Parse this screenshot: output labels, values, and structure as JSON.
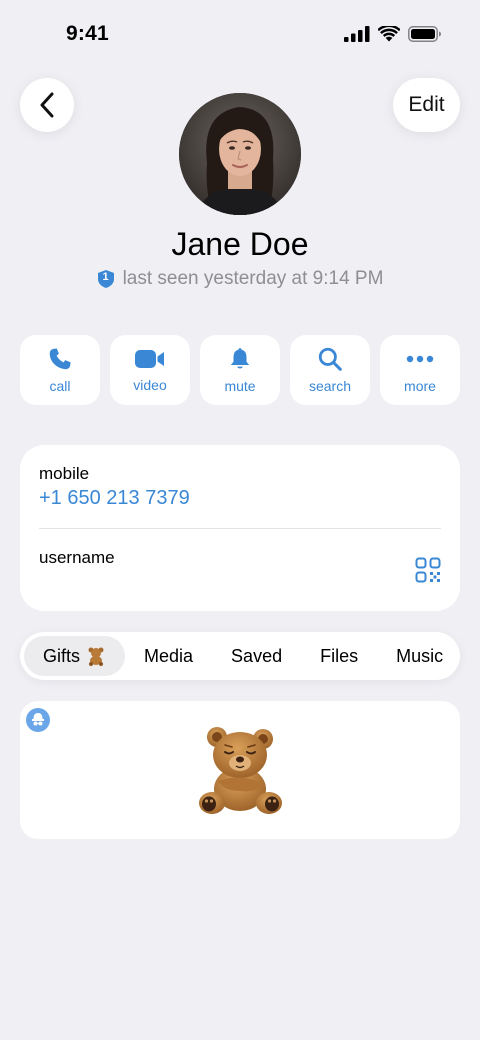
{
  "status_bar": {
    "time": "9:41",
    "icons": [
      "signal-icon",
      "wifi-icon",
      "battery-icon"
    ]
  },
  "header": {
    "back_icon": "chevron-left-icon",
    "edit_label": "Edit"
  },
  "profile": {
    "name": "Jane Doe",
    "status": "last seen yesterday at 9:14 PM",
    "status_badge": "1"
  },
  "actions": [
    {
      "label": "call",
      "icon": "phone-icon"
    },
    {
      "label": "video",
      "icon": "video-camera-icon"
    },
    {
      "label": "mute",
      "icon": "bell-icon"
    },
    {
      "label": "search",
      "icon": "search-icon"
    },
    {
      "label": "more",
      "icon": "ellipsis-icon"
    }
  ],
  "info": {
    "mobile_label": "mobile",
    "phone": "+1 650 213 7379",
    "username_label": "username",
    "qr_icon": "qr-code-icon"
  },
  "tabs": [
    {
      "label": "Gifts",
      "active": true
    },
    {
      "label": "Media",
      "active": false
    },
    {
      "label": "Saved",
      "active": false
    },
    {
      "label": "Files",
      "active": false
    },
    {
      "label": "Music",
      "active": false
    }
  ],
  "gifts": {
    "items": [
      {
        "icon": "teddy-bear-icon",
        "badge": "gift-badge-icon"
      }
    ]
  },
  "colors": {
    "accent": "#3a87d6",
    "background": "#efeff4",
    "secondary_text": "#8e8e93"
  }
}
